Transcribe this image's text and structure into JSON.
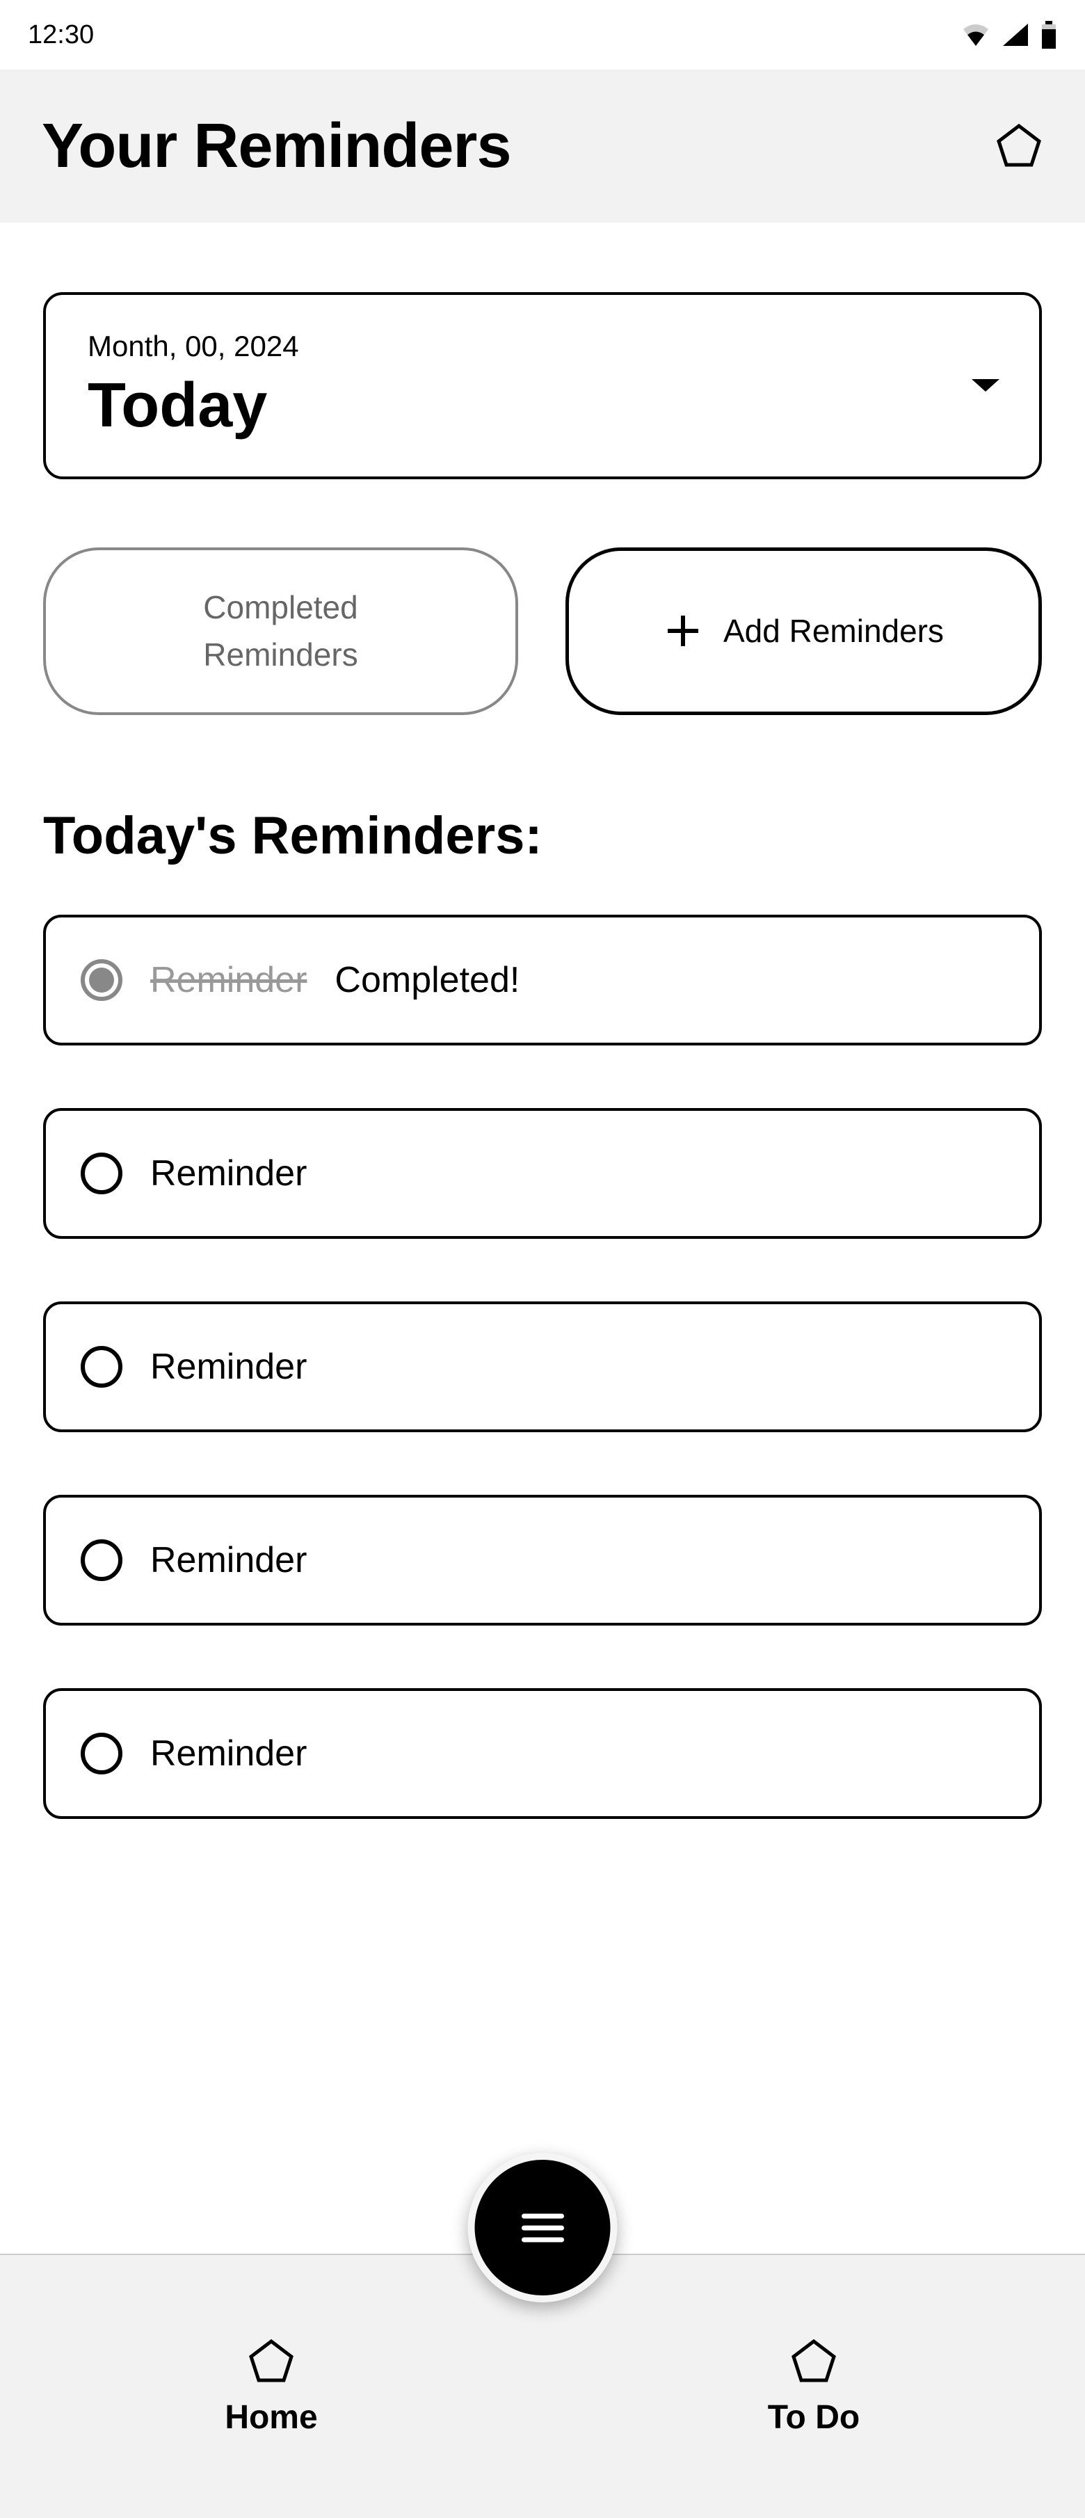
{
  "statusBar": {
    "time": "12:30"
  },
  "header": {
    "title": "Your Reminders"
  },
  "dateSelector": {
    "date": "Month, 00, 2024",
    "label": "Today"
  },
  "buttons": {
    "completed": "Completed Reminders",
    "completedLine1": "Completed",
    "completedLine2": "Reminders",
    "add": "Add Reminders"
  },
  "section": {
    "title": "Today's Reminders:"
  },
  "reminders": [
    {
      "label": "Reminder",
      "completed": true,
      "completedText": "Completed!"
    },
    {
      "label": "Reminder",
      "completed": false
    },
    {
      "label": "Reminder",
      "completed": false
    },
    {
      "label": "Reminder",
      "completed": false
    },
    {
      "label": "Reminder",
      "completed": false
    }
  ],
  "nav": {
    "home": "Home",
    "todo": "To Do"
  }
}
